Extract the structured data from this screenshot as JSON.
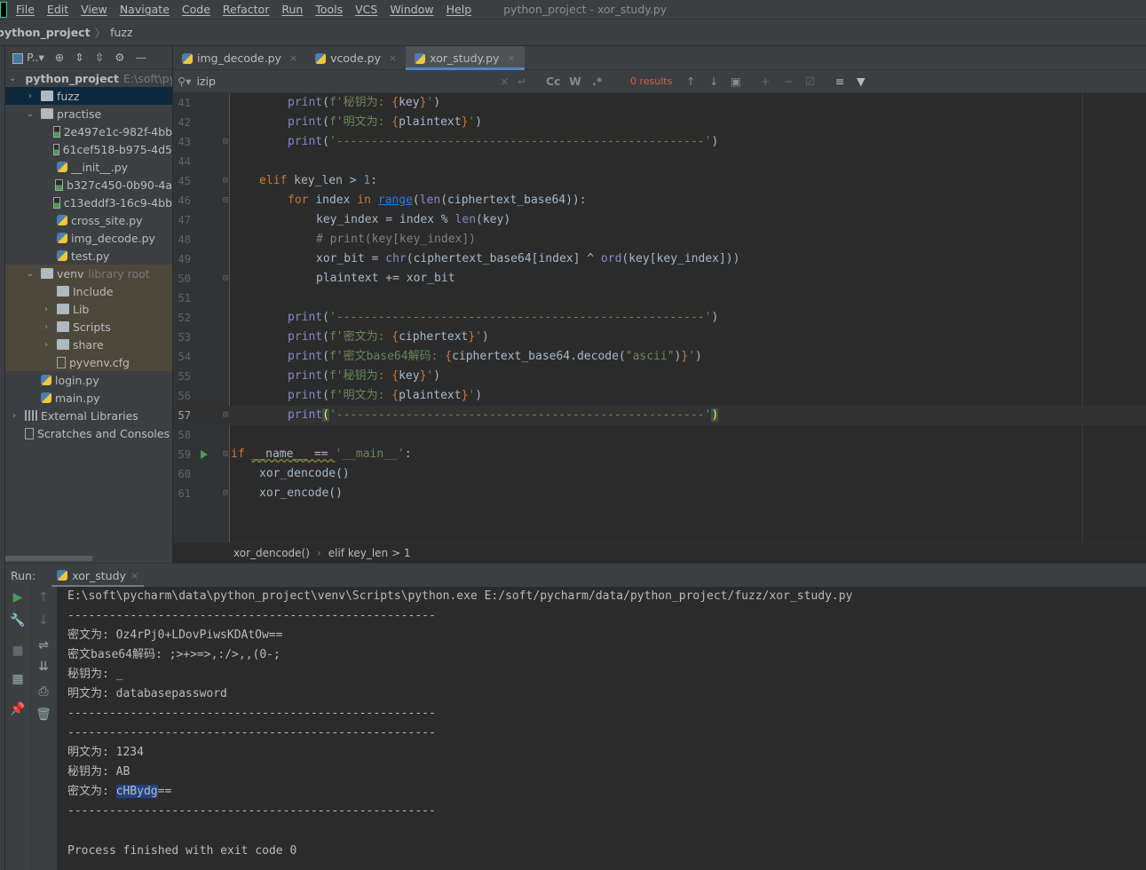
{
  "window": {
    "title": "python_project - xor_study.py",
    "menu": [
      "File",
      "Edit",
      "View",
      "Navigate",
      "Code",
      "Refactor",
      "Run",
      "Tools",
      "VCS",
      "Window",
      "Help"
    ]
  },
  "nav": {
    "project": "python_project",
    "folder": "fuzz"
  },
  "project_panel": {
    "selector": "P..▾",
    "root": {
      "name": "python_project",
      "path": "E:\\soft\\pycharm\\data\\python_project"
    },
    "items": [
      {
        "label": "fuzz",
        "type": "folder",
        "level": 1,
        "state": "collapsed",
        "selected": true
      },
      {
        "label": "practise",
        "type": "folder",
        "level": 1,
        "state": "expanded"
      },
      {
        "label": "2e497e1c-982f-4bb",
        "type": "image",
        "level": 2
      },
      {
        "label": "61cef518-b975-4d5",
        "type": "image",
        "level": 2
      },
      {
        "label": "__init__.py",
        "type": "python",
        "level": 2
      },
      {
        "label": "b327c450-0b90-4a",
        "type": "image",
        "level": 2
      },
      {
        "label": "c13eddf3-16c9-4bb",
        "type": "image",
        "level": 2
      },
      {
        "label": "cross_site.py",
        "type": "python",
        "level": 2
      },
      {
        "label": "img_decode.py",
        "type": "python",
        "level": 2
      },
      {
        "label": "test.py",
        "type": "python",
        "level": 2
      },
      {
        "label": "venv",
        "type": "folder",
        "level": 1,
        "state": "expanded",
        "note": "library root",
        "venv": true
      },
      {
        "label": "Include",
        "type": "folder",
        "level": 2,
        "venv": true
      },
      {
        "label": "Lib",
        "type": "folder",
        "level": 2,
        "state": "collapsed",
        "venv": true
      },
      {
        "label": "Scripts",
        "type": "folder",
        "level": 2,
        "state": "collapsed",
        "venv": true
      },
      {
        "label": "share",
        "type": "folder",
        "level": 2,
        "state": "collapsed",
        "venv": true
      },
      {
        "label": "pyvenv.cfg",
        "type": "config",
        "level": 2,
        "venv": true
      },
      {
        "label": "login.py",
        "type": "python",
        "level": 1
      },
      {
        "label": "main.py",
        "type": "python",
        "level": 1
      },
      {
        "label": "External Libraries",
        "type": "libraries",
        "level": 0,
        "state": "collapsed"
      },
      {
        "label": "Scratches and Consoles",
        "type": "scratches",
        "level": 0
      }
    ]
  },
  "tabs": [
    {
      "label": "img_decode.py",
      "active": false
    },
    {
      "label": "vcode.py",
      "active": false
    },
    {
      "label": "xor_study.py",
      "active": true
    }
  ],
  "search": {
    "value": "izip",
    "results": "0 results",
    "match_case": "Cc",
    "words": "W",
    "regex": ".*"
  },
  "code": {
    "current_line": 57,
    "lines": [
      {
        "n": 41,
        "indent": 2,
        "t": [
          [
            "bi",
            "print"
          ],
          [
            "pl",
            "("
          ],
          [
            "st",
            "f'秘钥为: "
          ],
          [
            "br",
            "{"
          ],
          [
            "pl",
            "key"
          ],
          [
            "br",
            "}"
          ],
          [
            "st",
            "'"
          ],
          [
            "pl",
            ")"
          ]
        ]
      },
      {
        "n": 42,
        "indent": 2,
        "t": [
          [
            "bi",
            "print"
          ],
          [
            "pl",
            "("
          ],
          [
            "st",
            "f'明文为: "
          ],
          [
            "br",
            "{"
          ],
          [
            "pl",
            "plaintext"
          ],
          [
            "br",
            "}"
          ],
          [
            "st",
            "'"
          ],
          [
            "pl",
            ")"
          ]
        ]
      },
      {
        "n": 43,
        "indent": 2,
        "fold": true,
        "t": [
          [
            "bi",
            "print"
          ],
          [
            "pl",
            "("
          ],
          [
            "st",
            "'-----------------------------------------------------'"
          ],
          [
            "pl",
            ")"
          ]
        ]
      },
      {
        "n": 44,
        "indent": 0,
        "t": []
      },
      {
        "n": 45,
        "indent": 1,
        "fold": true,
        "t": [
          [
            "kw",
            "elif "
          ],
          [
            "pl",
            "key_len > "
          ],
          [
            "nu",
            "1"
          ],
          [
            "pl",
            ":"
          ]
        ]
      },
      {
        "n": 46,
        "indent": 2,
        "fold": true,
        "t": [
          [
            "kw",
            "for "
          ],
          [
            "pl",
            "index "
          ],
          [
            "kw",
            "in "
          ],
          [
            "lk",
            "range"
          ],
          [
            "pl",
            "("
          ],
          [
            "bi",
            "len"
          ],
          [
            "pl",
            "(ciphertext_base64)):"
          ]
        ]
      },
      {
        "n": 47,
        "indent": 3,
        "t": [
          [
            "pl",
            "key_index = index % "
          ],
          [
            "bi",
            "len"
          ],
          [
            "pl",
            "(key)"
          ]
        ]
      },
      {
        "n": 48,
        "indent": 3,
        "t": [
          [
            "cm",
            "# print(key[key_index])"
          ]
        ]
      },
      {
        "n": 49,
        "indent": 3,
        "t": [
          [
            "pl",
            "xor_bit = "
          ],
          [
            "bi",
            "chr"
          ],
          [
            "pl",
            "(ciphertext_base64[index] ^ "
          ],
          [
            "bi",
            "ord"
          ],
          [
            "pl",
            "(key[key_index]))"
          ]
        ]
      },
      {
        "n": 50,
        "indent": 3,
        "fold": true,
        "t": [
          [
            "pl",
            "plaintext += xor_bit"
          ]
        ]
      },
      {
        "n": 51,
        "indent": 0,
        "t": []
      },
      {
        "n": 52,
        "indent": 2,
        "t": [
          [
            "bi",
            "print"
          ],
          [
            "pl",
            "("
          ],
          [
            "st",
            "'-----------------------------------------------------'"
          ],
          [
            "pl",
            ")"
          ]
        ]
      },
      {
        "n": 53,
        "indent": 2,
        "t": [
          [
            "bi",
            "print"
          ],
          [
            "pl",
            "("
          ],
          [
            "st",
            "f'密文为: "
          ],
          [
            "br",
            "{"
          ],
          [
            "pl",
            "ciphertext"
          ],
          [
            "br",
            "}"
          ],
          [
            "st",
            "'"
          ],
          [
            "pl",
            ")"
          ]
        ]
      },
      {
        "n": 54,
        "indent": 2,
        "t": [
          [
            "bi",
            "print"
          ],
          [
            "pl",
            "("
          ],
          [
            "st",
            "f'密文base64解码: "
          ],
          [
            "br",
            "{"
          ],
          [
            "pl",
            "ciphertext_base64.decode("
          ],
          [
            "st",
            "\"ascii\""
          ],
          [
            "pl",
            ")"
          ],
          [
            "br",
            "}"
          ],
          [
            "st",
            "'"
          ],
          [
            "pl",
            ")"
          ]
        ]
      },
      {
        "n": 55,
        "indent": 2,
        "t": [
          [
            "bi",
            "print"
          ],
          [
            "pl",
            "("
          ],
          [
            "st",
            "f'秘钥为: "
          ],
          [
            "br",
            "{"
          ],
          [
            "pl",
            "key"
          ],
          [
            "br",
            "}"
          ],
          [
            "st",
            "'"
          ],
          [
            "pl",
            ")"
          ]
        ]
      },
      {
        "n": 56,
        "indent": 2,
        "t": [
          [
            "bi",
            "print"
          ],
          [
            "pl",
            "("
          ],
          [
            "st",
            "f'明文为: "
          ],
          [
            "br",
            "{"
          ],
          [
            "pl",
            "plaintext"
          ],
          [
            "br",
            "}"
          ],
          [
            "st",
            "'"
          ],
          [
            "pl",
            ")"
          ]
        ]
      },
      {
        "n": 57,
        "indent": 2,
        "fold": true,
        "t": [
          [
            "bi",
            "print"
          ],
          [
            "hl",
            "("
          ],
          [
            "st",
            "'-----------------------------------------------------'"
          ],
          [
            "hl",
            ")"
          ]
        ]
      },
      {
        "n": 58,
        "indent": 0,
        "t": []
      },
      {
        "n": 59,
        "indent": 0,
        "fold": true,
        "run": true,
        "t": [
          [
            "kw",
            "if "
          ],
          [
            "mg",
            "__name__ == "
          ],
          [
            "st",
            "'__main__'"
          ],
          [
            "pl",
            ":"
          ]
        ]
      },
      {
        "n": 60,
        "indent": 1,
        "t": [
          [
            "pl",
            "xor_dencode()"
          ]
        ]
      },
      {
        "n": 61,
        "indent": 1,
        "fold": true,
        "t": [
          [
            "pl",
            "xor_encode()"
          ]
        ]
      }
    ]
  },
  "breadcrumbs": [
    "xor_dencode()",
    "elif key_len > 1"
  ],
  "run": {
    "label": "Run:",
    "tab": "xor_study",
    "output": [
      "E:\\soft\\pycharm\\data\\python_project\\venv\\Scripts\\python.exe E:/soft/pycharm/data/python_project/fuzz/xor_study.py",
      "-----------------------------------------------------",
      "密文为: Oz4rPj0+LDovPiwsKDAtOw==",
      "密文base64解码: ;>+>=>,:/>,,(0-;",
      "秘钥为: _",
      "明文为: databasepassword",
      "-----------------------------------------------------",
      "-----------------------------------------------------",
      "明文为: 1234",
      "秘钥为: AB",
      "密文为: ",
      "-----------------------------------------------------",
      "",
      "Process finished with exit code 0"
    ],
    "selected_text": "cHBydg",
    "after_selection": "=="
  }
}
